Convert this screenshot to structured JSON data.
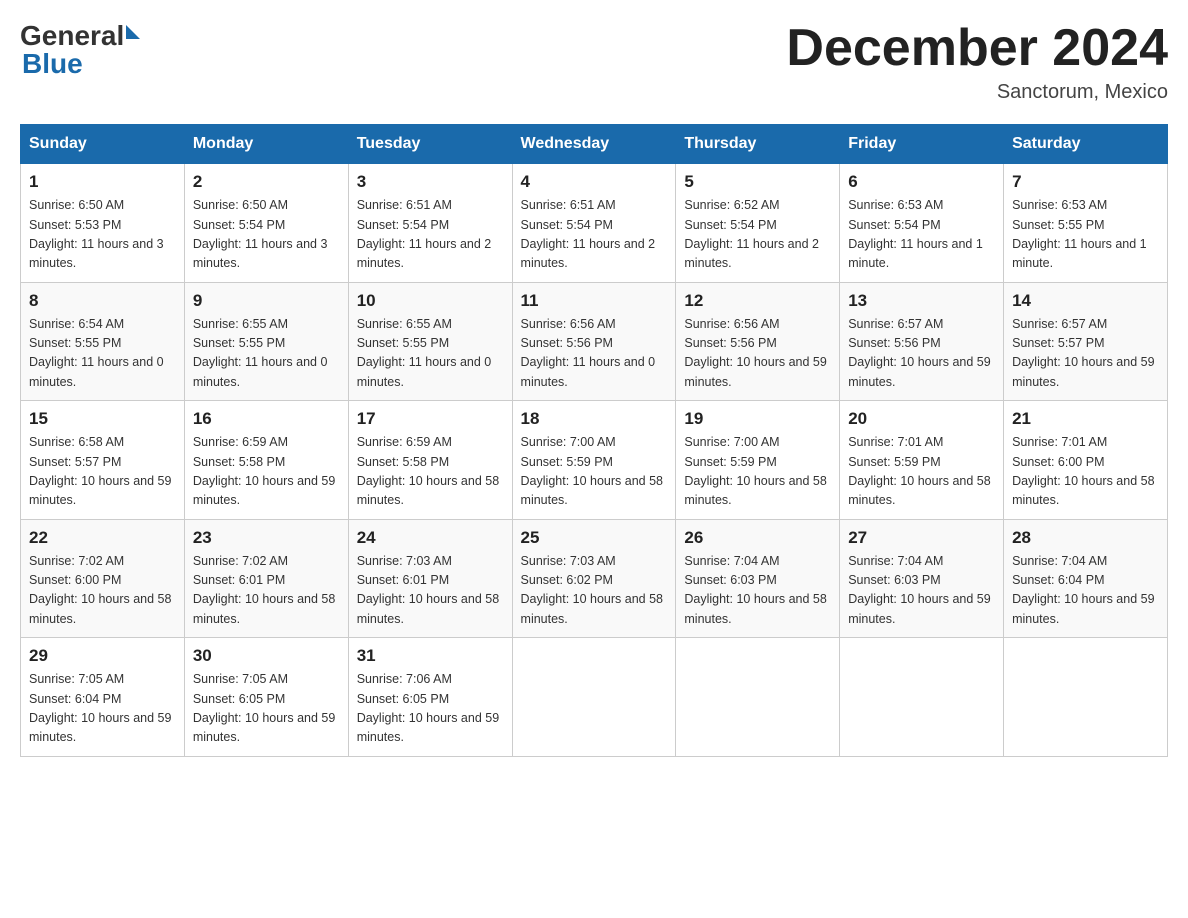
{
  "header": {
    "logo": {
      "text_general": "General",
      "triangle": "▶",
      "text_blue": "Blue"
    },
    "title": "December 2024",
    "location": "Sanctorum, Mexico"
  },
  "calendar": {
    "days_of_week": [
      "Sunday",
      "Monday",
      "Tuesday",
      "Wednesday",
      "Thursday",
      "Friday",
      "Saturday"
    ],
    "weeks": [
      [
        {
          "day": "1",
          "sunrise": "6:50 AM",
          "sunset": "5:53 PM",
          "daylight": "11 hours and 3 minutes."
        },
        {
          "day": "2",
          "sunrise": "6:50 AM",
          "sunset": "5:54 PM",
          "daylight": "11 hours and 3 minutes."
        },
        {
          "day": "3",
          "sunrise": "6:51 AM",
          "sunset": "5:54 PM",
          "daylight": "11 hours and 2 minutes."
        },
        {
          "day": "4",
          "sunrise": "6:51 AM",
          "sunset": "5:54 PM",
          "daylight": "11 hours and 2 minutes."
        },
        {
          "day": "5",
          "sunrise": "6:52 AM",
          "sunset": "5:54 PM",
          "daylight": "11 hours and 2 minutes."
        },
        {
          "day": "6",
          "sunrise": "6:53 AM",
          "sunset": "5:54 PM",
          "daylight": "11 hours and 1 minute."
        },
        {
          "day": "7",
          "sunrise": "6:53 AM",
          "sunset": "5:55 PM",
          "daylight": "11 hours and 1 minute."
        }
      ],
      [
        {
          "day": "8",
          "sunrise": "6:54 AM",
          "sunset": "5:55 PM",
          "daylight": "11 hours and 0 minutes."
        },
        {
          "day": "9",
          "sunrise": "6:55 AM",
          "sunset": "5:55 PM",
          "daylight": "11 hours and 0 minutes."
        },
        {
          "day": "10",
          "sunrise": "6:55 AM",
          "sunset": "5:55 PM",
          "daylight": "11 hours and 0 minutes."
        },
        {
          "day": "11",
          "sunrise": "6:56 AM",
          "sunset": "5:56 PM",
          "daylight": "11 hours and 0 minutes."
        },
        {
          "day": "12",
          "sunrise": "6:56 AM",
          "sunset": "5:56 PM",
          "daylight": "10 hours and 59 minutes."
        },
        {
          "day": "13",
          "sunrise": "6:57 AM",
          "sunset": "5:56 PM",
          "daylight": "10 hours and 59 minutes."
        },
        {
          "day": "14",
          "sunrise": "6:57 AM",
          "sunset": "5:57 PM",
          "daylight": "10 hours and 59 minutes."
        }
      ],
      [
        {
          "day": "15",
          "sunrise": "6:58 AM",
          "sunset": "5:57 PM",
          "daylight": "10 hours and 59 minutes."
        },
        {
          "day": "16",
          "sunrise": "6:59 AM",
          "sunset": "5:58 PM",
          "daylight": "10 hours and 59 minutes."
        },
        {
          "day": "17",
          "sunrise": "6:59 AM",
          "sunset": "5:58 PM",
          "daylight": "10 hours and 58 minutes."
        },
        {
          "day": "18",
          "sunrise": "7:00 AM",
          "sunset": "5:59 PM",
          "daylight": "10 hours and 58 minutes."
        },
        {
          "day": "19",
          "sunrise": "7:00 AM",
          "sunset": "5:59 PM",
          "daylight": "10 hours and 58 minutes."
        },
        {
          "day": "20",
          "sunrise": "7:01 AM",
          "sunset": "5:59 PM",
          "daylight": "10 hours and 58 minutes."
        },
        {
          "day": "21",
          "sunrise": "7:01 AM",
          "sunset": "6:00 PM",
          "daylight": "10 hours and 58 minutes."
        }
      ],
      [
        {
          "day": "22",
          "sunrise": "7:02 AM",
          "sunset": "6:00 PM",
          "daylight": "10 hours and 58 minutes."
        },
        {
          "day": "23",
          "sunrise": "7:02 AM",
          "sunset": "6:01 PM",
          "daylight": "10 hours and 58 minutes."
        },
        {
          "day": "24",
          "sunrise": "7:03 AM",
          "sunset": "6:01 PM",
          "daylight": "10 hours and 58 minutes."
        },
        {
          "day": "25",
          "sunrise": "7:03 AM",
          "sunset": "6:02 PM",
          "daylight": "10 hours and 58 minutes."
        },
        {
          "day": "26",
          "sunrise": "7:04 AM",
          "sunset": "6:03 PM",
          "daylight": "10 hours and 58 minutes."
        },
        {
          "day": "27",
          "sunrise": "7:04 AM",
          "sunset": "6:03 PM",
          "daylight": "10 hours and 59 minutes."
        },
        {
          "day": "28",
          "sunrise": "7:04 AM",
          "sunset": "6:04 PM",
          "daylight": "10 hours and 59 minutes."
        }
      ],
      [
        {
          "day": "29",
          "sunrise": "7:05 AM",
          "sunset": "6:04 PM",
          "daylight": "10 hours and 59 minutes."
        },
        {
          "day": "30",
          "sunrise": "7:05 AM",
          "sunset": "6:05 PM",
          "daylight": "10 hours and 59 minutes."
        },
        {
          "day": "31",
          "sunrise": "7:06 AM",
          "sunset": "6:05 PM",
          "daylight": "10 hours and 59 minutes."
        },
        null,
        null,
        null,
        null
      ]
    ]
  }
}
